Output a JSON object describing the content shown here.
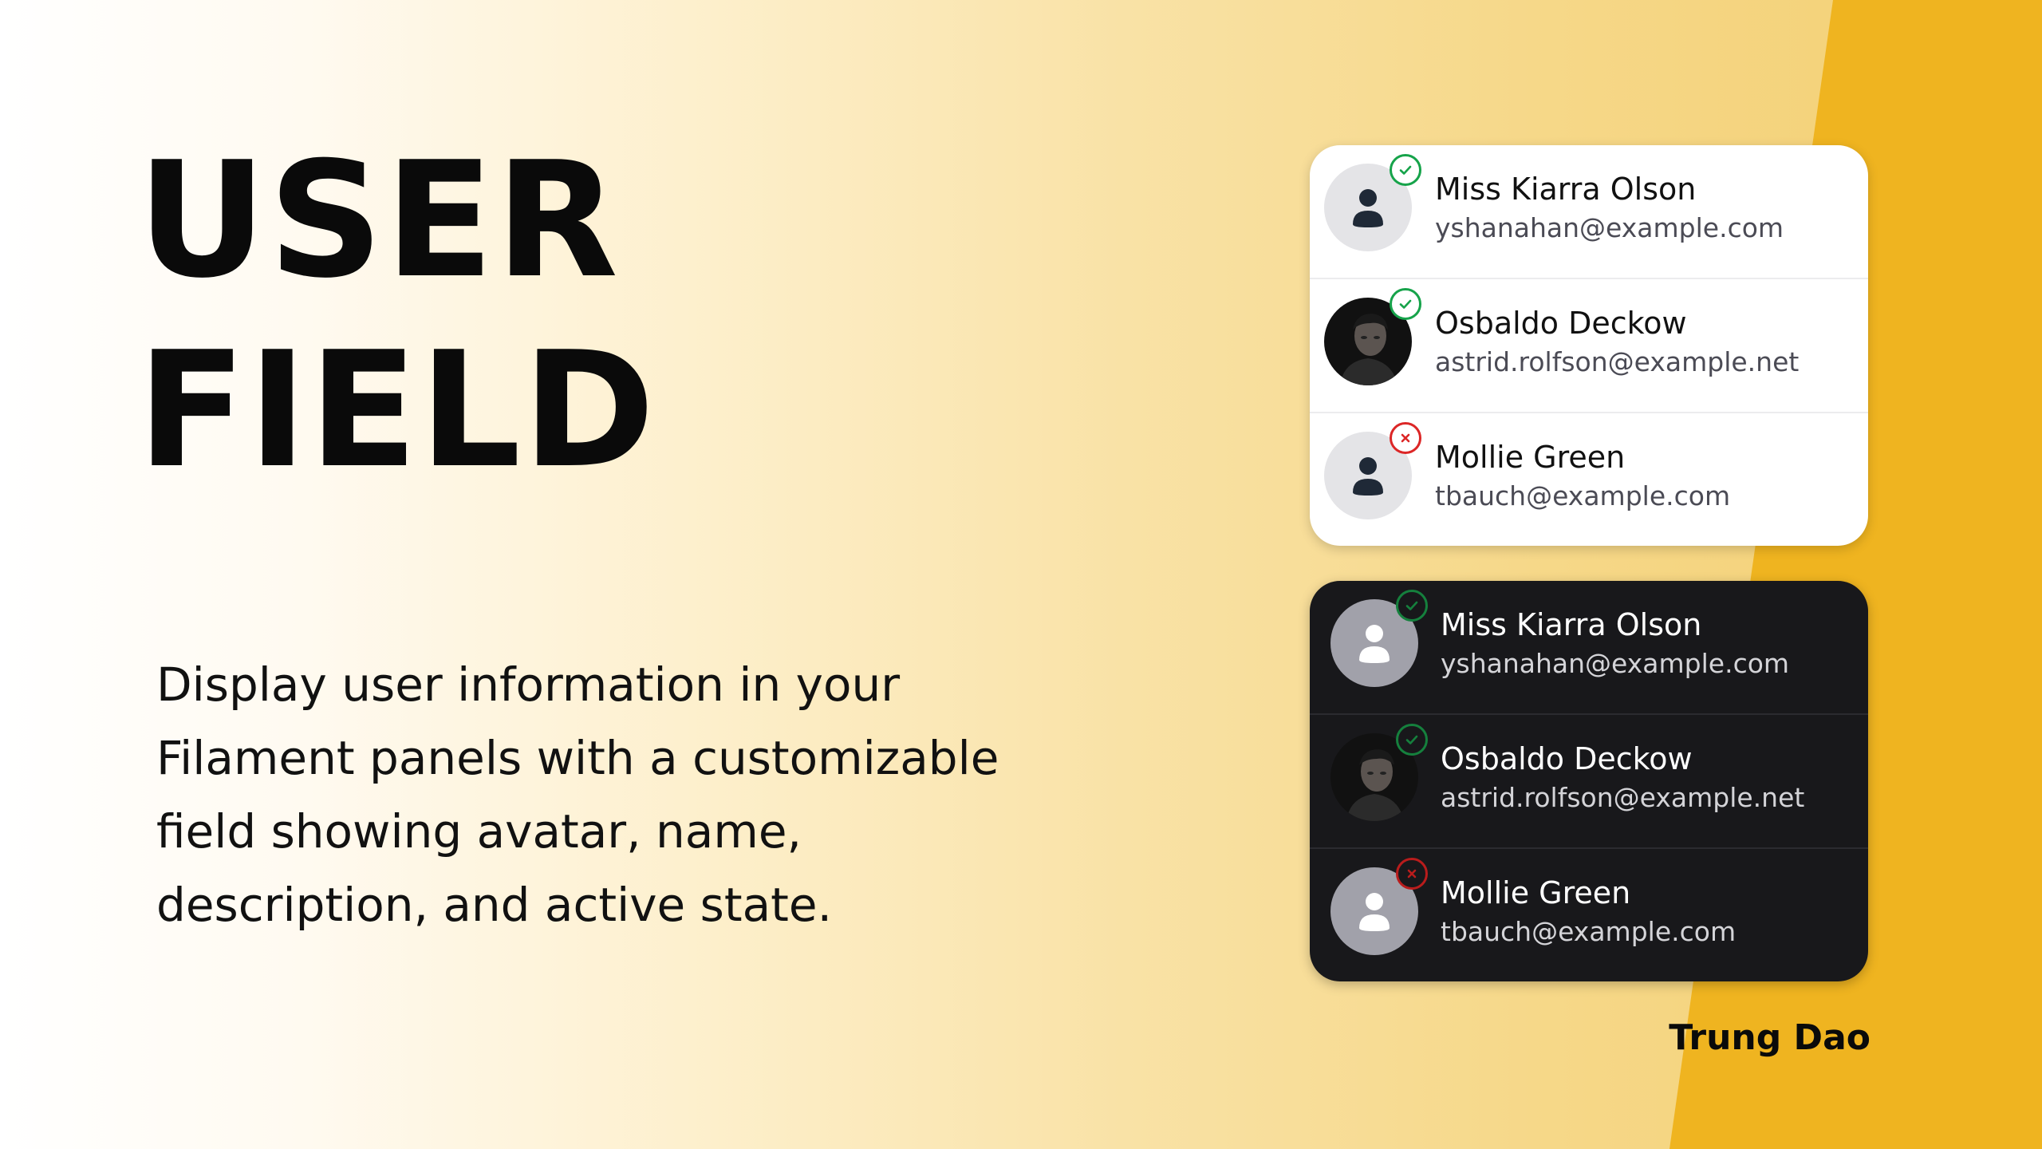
{
  "hero": {
    "title_line1": "USER",
    "title_line2": "FIELD",
    "description": "Display user information in your Filament panels with a customizable field showing avatar, name, description, and active state."
  },
  "author": "Trung Dao",
  "colors": {
    "accent": "#efb420",
    "active": "#16a34a",
    "inactive": "#dc2626",
    "dark_card": "#18181b",
    "light_card": "#ffffff"
  },
  "light_card": {
    "users": [
      {
        "name": "Miss Kiarra Olson",
        "email": "yshanahan@example.com",
        "avatar": "placeholder-user-icon",
        "status": "active"
      },
      {
        "name": "Osbaldo Deckow",
        "email": "astrid.rolfson@example.net",
        "avatar": "portrait-photo",
        "status": "active"
      },
      {
        "name": "Mollie Green",
        "email": "tbauch@example.com",
        "avatar": "placeholder-user-icon",
        "status": "inactive"
      }
    ]
  },
  "dark_card": {
    "users": [
      {
        "name": "Miss Kiarra Olson",
        "email": "yshanahan@example.com",
        "avatar": "placeholder-user-icon",
        "status": "active"
      },
      {
        "name": "Osbaldo Deckow",
        "email": "astrid.rolfson@example.net",
        "avatar": "portrait-photo",
        "status": "active"
      },
      {
        "name": "Mollie Green",
        "email": "tbauch@example.com",
        "avatar": "placeholder-user-icon",
        "status": "inactive"
      }
    ]
  }
}
